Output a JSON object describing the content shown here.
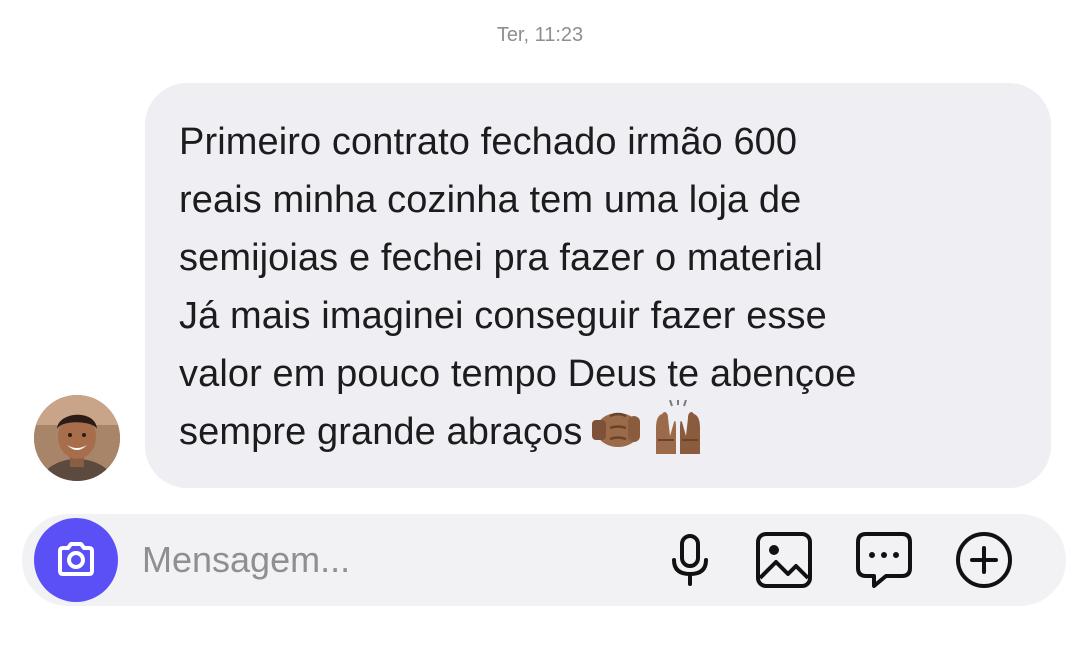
{
  "header": {
    "timestamp": "Ter, 11:23"
  },
  "message": {
    "sender_avatar_icon": "avatar-photo",
    "lines": [
      "Primeiro contrato fechado irmão 600",
      "reais minha cozinha tem uma loja de",
      "semijoias e fechei pra fazer o material",
      "Já mais imaginei conseguir fazer esse",
      "valor em pouco tempo Deus te abençoe",
      "sempre grande abraços"
    ],
    "emojis": [
      "fist-bump-emoji",
      "raising-hands-emoji"
    ]
  },
  "composer": {
    "placeholder": "Mensagem...",
    "value": "",
    "camera_icon": "camera-icon",
    "tools": [
      "microphone-icon",
      "image-icon",
      "sticker-chat-icon",
      "add-circle-icon"
    ],
    "accent_color": "#5b50f5"
  }
}
